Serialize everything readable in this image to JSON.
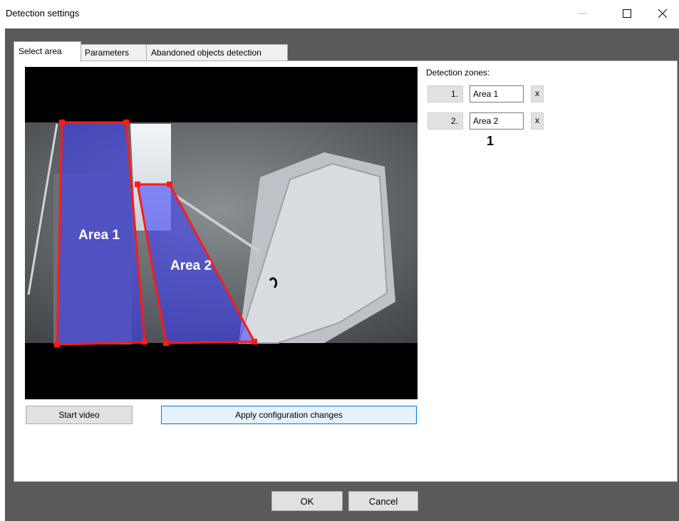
{
  "window": {
    "title": "Detection settings",
    "controls": [
      "minimize-icon",
      "maximize-icon",
      "close-icon"
    ]
  },
  "tabs": [
    {
      "label": "Select area",
      "active": true
    },
    {
      "label": "Parameters",
      "active": false
    },
    {
      "label": "Abandoned objects detection",
      "active": false
    }
  ],
  "video": {
    "areas": [
      {
        "label": "Area 1",
        "color": "#ff1a1a"
      },
      {
        "label": "Area 2",
        "color": "#ff1a1a"
      }
    ],
    "start_button": "Start video",
    "apply_button": "Apply configuration changes"
  },
  "zones": {
    "label": "Detection zones:",
    "items": [
      {
        "num": "1.",
        "name": "Area 1",
        "remove": "x"
      },
      {
        "num": "2.",
        "name": "Area 2",
        "remove": "x"
      }
    ],
    "selected_indicator": "1"
  },
  "footer": {
    "ok": "OK",
    "cancel": "Cancel"
  },
  "colors": {
    "frame": "#5a5a5a",
    "zone_fill": "#3b3bff",
    "zone_outline": "#ff1a1a",
    "accent": "#0078d7"
  }
}
